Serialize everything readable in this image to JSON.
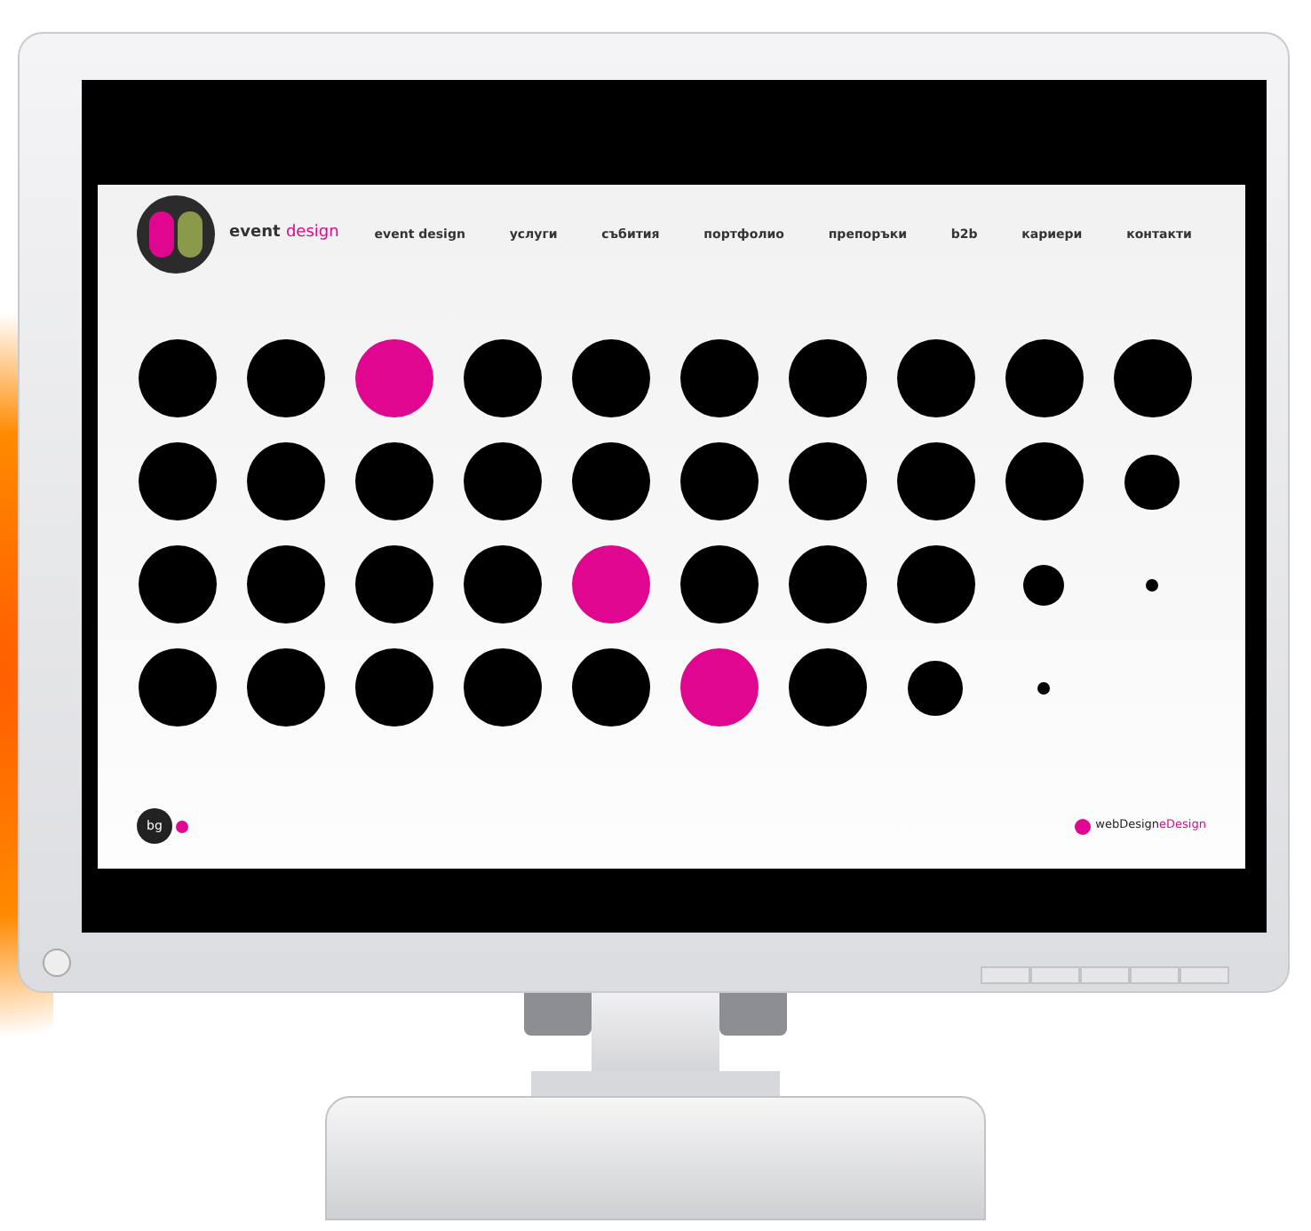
{
  "header": {
    "brand_word": "event",
    "brand_accent": "design",
    "nav": [
      {
        "label": "event design"
      },
      {
        "label": "услуги"
      },
      {
        "label": "събития"
      },
      {
        "label": "портфолио"
      },
      {
        "label": "препоръки"
      },
      {
        "label": "b2b"
      },
      {
        "label": "кариери"
      },
      {
        "label": "контакти"
      }
    ]
  },
  "dot_grid": [
    {
      "dots": [
        {
          "kind": "large",
          "color": "#000000"
        },
        {
          "kind": "large",
          "color": "#000000"
        },
        {
          "kind": "large",
          "color": "#e0068f"
        },
        {
          "kind": "large",
          "color": "#000000"
        },
        {
          "kind": "large",
          "color": "#000000"
        },
        {
          "kind": "large",
          "color": "#000000"
        },
        {
          "kind": "large",
          "color": "#000000"
        },
        {
          "kind": "large",
          "color": "#000000"
        },
        {
          "kind": "large",
          "color": "#000000"
        },
        {
          "kind": "large",
          "color": "#000000"
        }
      ]
    },
    {
      "dots": [
        {
          "kind": "large",
          "color": "#000000"
        },
        {
          "kind": "large",
          "color": "#000000"
        },
        {
          "kind": "large",
          "color": "#000000"
        },
        {
          "kind": "large",
          "color": "#000000"
        },
        {
          "kind": "large",
          "color": "#000000"
        },
        {
          "kind": "large",
          "color": "#000000"
        },
        {
          "kind": "large",
          "color": "#000000"
        },
        {
          "kind": "large",
          "color": "#000000"
        },
        {
          "kind": "large",
          "color": "#000000"
        },
        {
          "kind": "medium",
          "color": "#000000"
        }
      ]
    },
    {
      "dots": [
        {
          "kind": "large",
          "color": "#000000"
        },
        {
          "kind": "large",
          "color": "#000000"
        },
        {
          "kind": "large",
          "color": "#000000"
        },
        {
          "kind": "large",
          "color": "#000000"
        },
        {
          "kind": "large",
          "color": "#e0068f"
        },
        {
          "kind": "large",
          "color": "#000000"
        },
        {
          "kind": "large",
          "color": "#000000"
        },
        {
          "kind": "large",
          "color": "#000000"
        },
        {
          "kind": "small",
          "color": "#000000"
        },
        {
          "kind": "tiny",
          "color": "#000000"
        }
      ]
    },
    {
      "dots": [
        {
          "kind": "large",
          "color": "#000000"
        },
        {
          "kind": "large",
          "color": "#000000"
        },
        {
          "kind": "large",
          "color": "#000000"
        },
        {
          "kind": "large",
          "color": "#000000"
        },
        {
          "kind": "large",
          "color": "#000000"
        },
        {
          "kind": "large",
          "color": "#e0068f"
        },
        {
          "kind": "large",
          "color": "#000000"
        },
        {
          "kind": "medium",
          "color": "#000000"
        },
        {
          "kind": "tiny",
          "color": "#000000"
        }
      ]
    }
  ],
  "footer": {
    "language": "bg",
    "credit_word": "webDesign",
    "credit_accent": "eDesign"
  }
}
